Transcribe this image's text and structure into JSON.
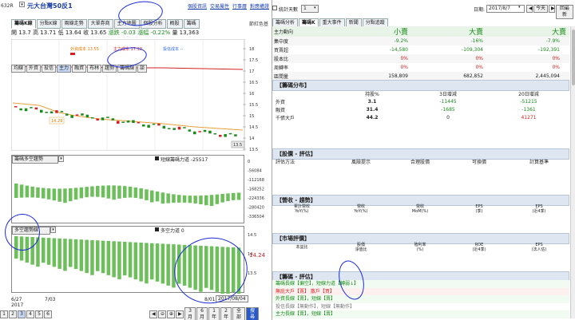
{
  "left": {
    "code": "632R",
    "stock_name": "元大台灣50反1",
    "top_links": [
      "個股資訊",
      "交易屬性",
      "行事曆",
      "對應權證"
    ],
    "tabs": [
      "籌碼K線",
      "分點K線",
      "兩線走勢",
      "大單券商",
      "主力地圖",
      "個股分析",
      "概股",
      "籌碼"
    ],
    "right_label": "節紅色基",
    "ohlc": {
      "open_label": "開",
      "open": "13.7",
      "high_label": "高",
      "high": "13.71",
      "low_label": "低",
      "low": "13.64",
      "close_label": "收",
      "close": "13.65",
      "chg_label": "漲跌",
      "chg": "-0.03",
      "pct_label": "漲幅",
      "pct": "-0.22%",
      "vol_label": "量",
      "vol": "13,363"
    },
    "ma_legend": [
      "外資成本 13.55",
      "主力成本 17.10",
      "投信成本 --"
    ],
    "price_axis": [
      "18",
      "17.5",
      "17",
      "16.5",
      "16",
      "15.5",
      "15",
      "14.5",
      "14",
      "13.5"
    ],
    "price_box": "14.29",
    "price_tag": "13.5",
    "sub_buttons": [
      "均線",
      "外資",
      "投信",
      "主力",
      "融資",
      "布林",
      "趨勢",
      "籌碼線",
      "談"
    ],
    "panel2_select": "籌碼多空趨勢",
    "panel2_legend": "短線籌碼力道 -25517",
    "panel2_axis": [
      "0",
      "-56084",
      "-112168",
      "-168252",
      "-224336",
      "-280420",
      "-336504"
    ],
    "panel3_select": "多空趨勢線",
    "panel3_legend": "多空力道 0",
    "panel3_axis": [
      "14.5",
      "14",
      "13.5"
    ],
    "panel3_value": "14.24",
    "date_labels": [
      "6/27",
      "7/03",
      "8/01"
    ],
    "year_label": "2017",
    "date_tip": "2017/08/04",
    "page_buttons": [
      "1",
      "2",
      "3",
      "4",
      "5",
      "6"
    ],
    "range_buttons": [
      "3月",
      "6月",
      "1年",
      "2年",
      "全部",
      "搜尋"
    ]
  },
  "right": {
    "checkbox_label": "統計天數",
    "days_select": "1",
    "date_label": "日期:",
    "date_value": "2017/8/7",
    "today_btn": "今天",
    "reset_btn": "回最新",
    "tabs": [
      "籌碼分析",
      "籌碼K",
      "重大事件",
      "新聞",
      "分點追蹤"
    ],
    "summary_header": [
      "主力動向",
      "小賣",
      "大賣",
      "大賣"
    ],
    "summary_rows": [
      {
        "label": "集中度",
        "v1": "-9.2%",
        "v2": "-16%",
        "v3": "-7.9%"
      },
      {
        "label": "買賣超",
        "v1": "-14,580",
        "v2": "-109,304",
        "v3": "-192,391"
      },
      {
        "label": "股本比",
        "v1": "0%",
        "v2": "0%",
        "v3": "0%"
      },
      {
        "label": "周轉率",
        "v1": "0%",
        "v2": "0%",
        "v3": "0%"
      },
      {
        "label": "區間量",
        "v1": "158,809",
        "v2": "682,852",
        "v3": "2,445,094"
      }
    ],
    "chip_title": "【籌碼分布】",
    "chip_cols": [
      "持股%",
      "3日增減",
      "20日增減"
    ],
    "chip_rows": [
      {
        "label": "外資",
        "a": "3.1",
        "b": "-11445",
        "c": "-51215"
      },
      {
        "label": "融資",
        "a": "31.4",
        "b": "-1685",
        "c": "-1361"
      },
      {
        "label": "千張大戶",
        "a": "44.2",
        "b": "0",
        "c": "41271"
      }
    ],
    "rating_title": "【股價 - 評估】",
    "rating_cols": [
      "評估方法",
      "風險提示",
      "合理股價",
      "可換價",
      "計算基準"
    ],
    "rev_title": "【營收 - 趨勢】",
    "rev_cols": [
      "累計營收\nYoY(%)",
      "營收\nYoY(%)",
      "營收\nMoM(%)",
      "EPS\n(季)",
      "EPS\n(近4季)"
    ],
    "market_title": "【市場評價】",
    "market_cols": [
      "本益比",
      "股價\n淨值比",
      "殖利率\n(%)",
      "ROE\n(近4季)",
      "EPS\n(法人估)"
    ],
    "eval_title": "【籌碼 - 評估】",
    "eval_lines": [
      {
        "text": "籌碼長線【偏空】，短線力道【轉弱↓】",
        "color": "#1a8a1a"
      },
      {
        "text": "無庇大戶【賣】    散戶【買】",
        "color": "#d42020"
      },
      {
        "text": "外資長線【賣】，短線【賣】",
        "color": "#1a8a1a"
      },
      {
        "text": "投信長線【無動作】，短線【無動作】",
        "color": "#777777"
      },
      {
        "text": "主力長線【賣】，短線【賣】",
        "color": "#1a8a1a"
      }
    ]
  }
}
